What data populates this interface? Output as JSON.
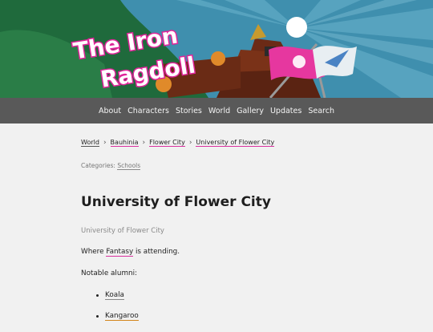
{
  "site": {
    "logo_text_line1": "The Iron",
    "logo_text_line2": "Ragdoll"
  },
  "nav": {
    "items": [
      {
        "label": "About"
      },
      {
        "label": "Characters"
      },
      {
        "label": "Stories"
      },
      {
        "label": "World"
      },
      {
        "label": "Gallery"
      },
      {
        "label": "Updates"
      },
      {
        "label": "Search"
      }
    ]
  },
  "breadcrumb": {
    "items": [
      {
        "label": "World"
      },
      {
        "label": "Bauhinia"
      },
      {
        "label": "Flower City"
      },
      {
        "label": "University of Flower City"
      }
    ],
    "separator": "›"
  },
  "categories": {
    "prefix": "Categories:",
    "link": "Schools"
  },
  "page": {
    "title": "University of Flower City",
    "subtitle": "University of Flower City",
    "attending_pre": "Where ",
    "attending_link": "Fantasy",
    "attending_post": " is attending.",
    "alumni_heading": "Notable alumni:",
    "alumni": [
      {
        "label": "Koala"
      },
      {
        "label": "Kangaroo"
      }
    ]
  },
  "colors": {
    "accent_pink": "#d9309f",
    "nav_bg": "#595959",
    "page_bg": "#f1f1f1",
    "sky": "#3f8fae",
    "hill": "#1f6a3c"
  }
}
